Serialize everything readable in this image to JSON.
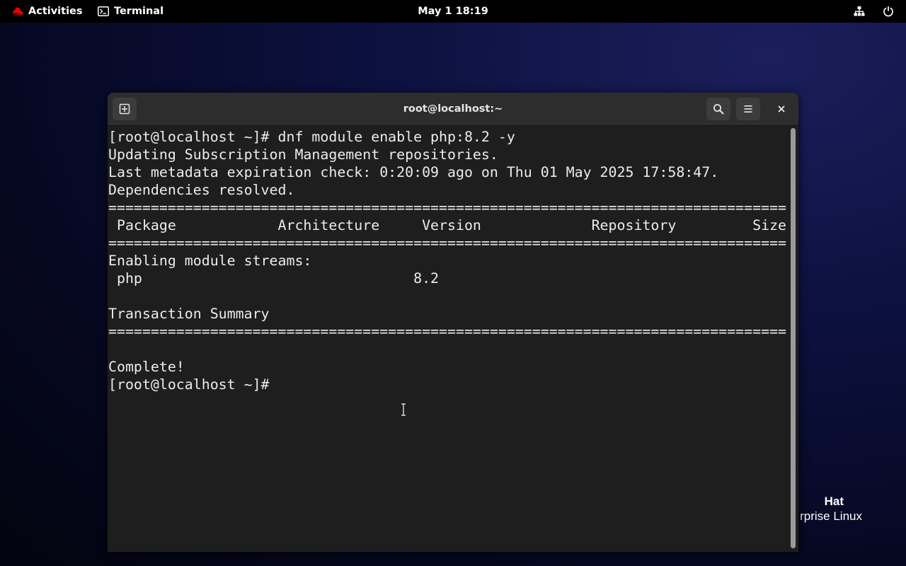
{
  "topbar": {
    "activities_label": "Activities",
    "app_label": "Terminal",
    "clock": "May 1  18:19"
  },
  "desktop": {
    "wordmark_line1": "Hat",
    "wordmark_line2": "rprise Linux"
  },
  "window": {
    "title": "root@localhost:~"
  },
  "terminal": {
    "lines": [
      "[root@localhost ~]# dnf module enable php:8.2 -y",
      "Updating Subscription Management repositories.",
      "Last metadata expiration check: 0:20:09 ago on Thu 01 May 2025 17:58:47.",
      "Dependencies resolved.",
      "================================================================================",
      " Package            Architecture     Version             Repository         Size",
      "================================================================================",
      "Enabling module streams:",
      " php                                8.2",
      "",
      "Transaction Summary",
      "================================================================================",
      "",
      "Complete!",
      "[root@localhost ~]# "
    ]
  },
  "colors": {
    "topbar_bg": "#000000",
    "terminal_bg": "#1e1e1e",
    "headerbar_bg": "#2d2d2d",
    "redhat_red": "#ee0000",
    "text": "#ececec"
  }
}
